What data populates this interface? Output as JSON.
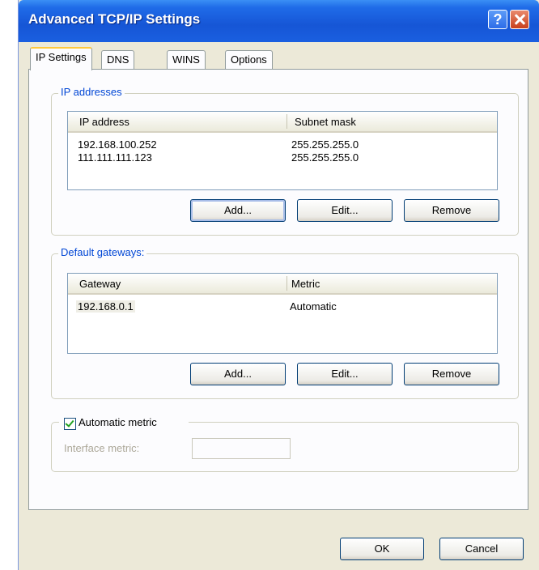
{
  "window": {
    "title": "Advanced TCP/IP Settings"
  },
  "tabs": [
    {
      "label": "IP Settings"
    },
    {
      "label": "DNS"
    },
    {
      "label": "WINS"
    },
    {
      "label": "Options"
    }
  ],
  "ip_addresses": {
    "title": "IP addresses",
    "columns": [
      "IP address",
      "Subnet mask"
    ],
    "rows": [
      {
        "ip": "192.168.100.252",
        "mask": "255.255.255.0"
      },
      {
        "ip": "111.111.111.123",
        "mask": "255.255.255.0"
      }
    ],
    "buttons": {
      "add": "Add...",
      "edit": "Edit...",
      "remove": "Remove"
    }
  },
  "gateways": {
    "title": "Default gateways:",
    "columns": [
      "Gateway",
      "Metric"
    ],
    "rows": [
      {
        "gateway": "192.168.0.1",
        "metric": "Automatic"
      }
    ],
    "buttons": {
      "add": "Add...",
      "edit": "Edit...",
      "remove": "Remove"
    }
  },
  "automatic_metric": {
    "label": "Automatic metric",
    "checked": true,
    "interface_metric_label": "Interface metric:",
    "interface_metric_value": ""
  },
  "footer": {
    "ok": "OK",
    "cancel": "Cancel"
  }
}
